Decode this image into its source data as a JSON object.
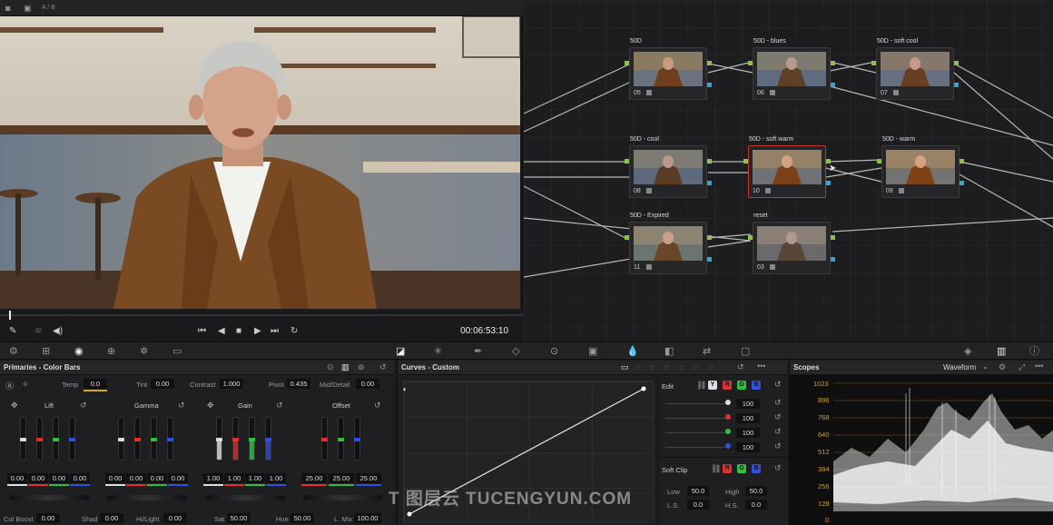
{
  "viewer": {
    "mode_label": "A / B",
    "timecode": "00:06:53:10"
  },
  "nodes": [
    {
      "label": "50D",
      "num": "05"
    },
    {
      "label": "50D - blues",
      "num": "06"
    },
    {
      "label": "50D - soft cool",
      "num": "07"
    },
    {
      "label": "50D - cool",
      "num": "08"
    },
    {
      "label": "50D - soft warm",
      "num": "10"
    },
    {
      "label": "50D - warm",
      "num": "09"
    },
    {
      "label": "50D - Expired",
      "num": "11"
    },
    {
      "label": "reset",
      "num": "03"
    }
  ],
  "primaries": {
    "title": "Primaries - Color Bars",
    "temp_label": "Temp",
    "temp": "0.0",
    "tint_label": "Tint",
    "tint": "0.00",
    "contrast_label": "Contrast",
    "contrast": "1.000",
    "pivot_label": "Pivot",
    "pivot": "0.435",
    "middetail_label": "Mid/Detail",
    "middetail": "0.00",
    "wheels": [
      {
        "name": "Lift",
        "values": [
          "0.00",
          "0.00",
          "0.00",
          "0.00"
        ]
      },
      {
        "name": "Gamma",
        "values": [
          "0.00",
          "0.00",
          "0.00",
          "0.00"
        ]
      },
      {
        "name": "Gain",
        "values": [
          "1.00",
          "1.00",
          "1.00",
          "1.00"
        ]
      },
      {
        "name": "Offset",
        "values": [
          "25.00",
          "25.00",
          "25.00"
        ]
      }
    ],
    "colboost_label": "Col Boost",
    "colboost": "0.00",
    "shad_label": "Shad",
    "shad": "0.00",
    "hilight_label": "Hi/Light",
    "hilight": "0.00",
    "sat_label": "Sat",
    "sat": "50.00",
    "hue_label": "Hue",
    "hue": "50.00",
    "lmix_label": "L. Mix",
    "lmix": "100.00"
  },
  "curves": {
    "title": "Curves - Custom",
    "edit_label": "Edit",
    "channels": [
      "Y",
      "R",
      "G",
      "B"
    ],
    "intensity": [
      "100",
      "100",
      "100",
      "100"
    ],
    "softclip_label": "Soft Clip",
    "low_label": "Low",
    "low": "50.0",
    "high_label": "High",
    "high": "50.0",
    "ls_label": "L.S.",
    "ls": "0.0",
    "hs_label": "H.S.",
    "hs": "0.0"
  },
  "scopes": {
    "title": "Scopes",
    "mode": "Waveform",
    "ticks": [
      "1023",
      "896",
      "768",
      "640",
      "512",
      "384",
      "256",
      "128",
      "0"
    ]
  },
  "watermark": "T 图层云 TUCENGYUN.COM"
}
